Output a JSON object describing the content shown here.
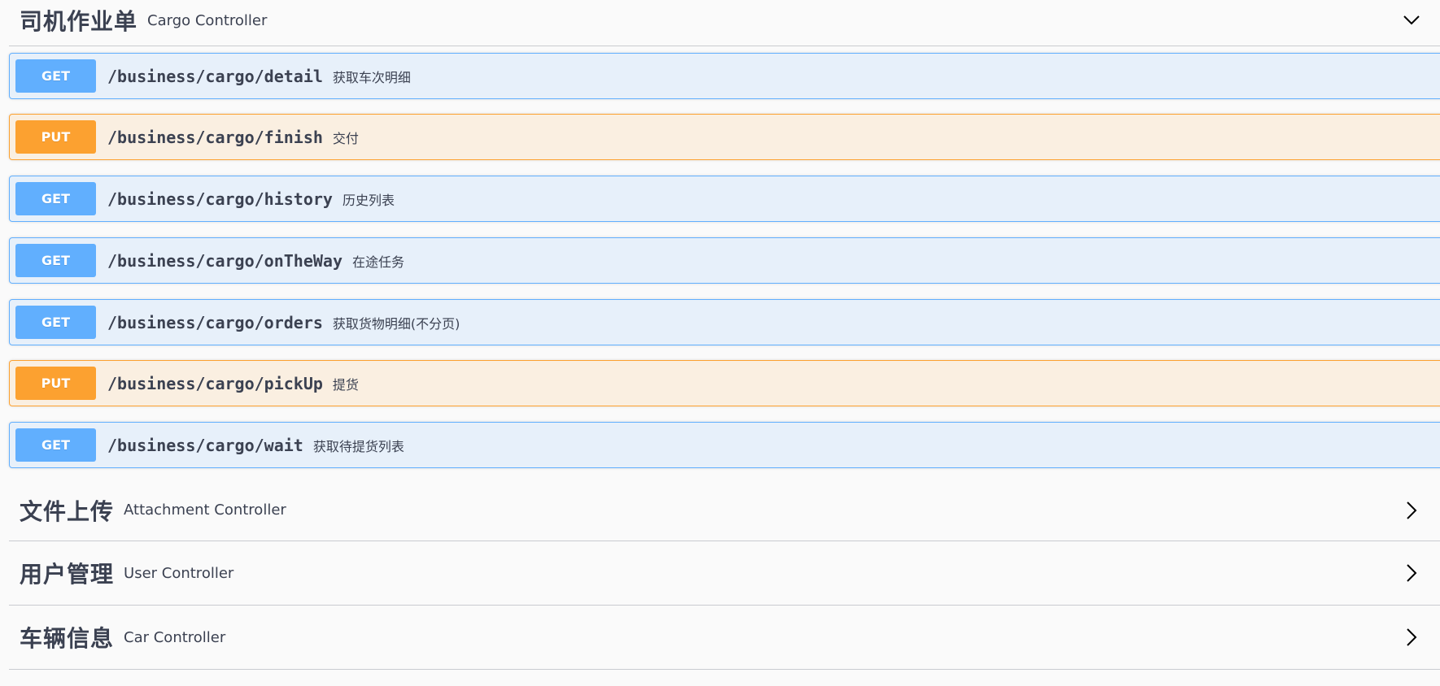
{
  "sections": [
    {
      "title": "司机作业单",
      "description": "Cargo Controller",
      "expanded": true,
      "chevron_icon": "chevron-down-icon",
      "operations": [
        {
          "method": "GET",
          "path": "/business/cargo/detail",
          "summary": "获取车次明细"
        },
        {
          "method": "PUT",
          "path": "/business/cargo/finish",
          "summary": "交付"
        },
        {
          "method": "GET",
          "path": "/business/cargo/history",
          "summary": "历史列表"
        },
        {
          "method": "GET",
          "path": "/business/cargo/onTheWay",
          "summary": "在途任务"
        },
        {
          "method": "GET",
          "path": "/business/cargo/orders",
          "summary": "获取货物明细(不分页)"
        },
        {
          "method": "PUT",
          "path": "/business/cargo/pickUp",
          "summary": "提货"
        },
        {
          "method": "GET",
          "path": "/business/cargo/wait",
          "summary": "获取待提货列表"
        }
      ]
    },
    {
      "title": "文件上传",
      "description": "Attachment Controller",
      "expanded": false,
      "chevron_icon": "chevron-right-icon"
    },
    {
      "title": "用户管理",
      "description": "User Controller",
      "expanded": false,
      "chevron_icon": "chevron-right-icon"
    },
    {
      "title": "车辆信息",
      "description": "Car Controller",
      "expanded": false,
      "chevron_icon": "chevron-right-icon"
    }
  ],
  "colors": {
    "get": "#61affe",
    "put": "#fca130",
    "text": "#3b4151",
    "divider": "#c9cbd0",
    "background": "#fafafa"
  }
}
